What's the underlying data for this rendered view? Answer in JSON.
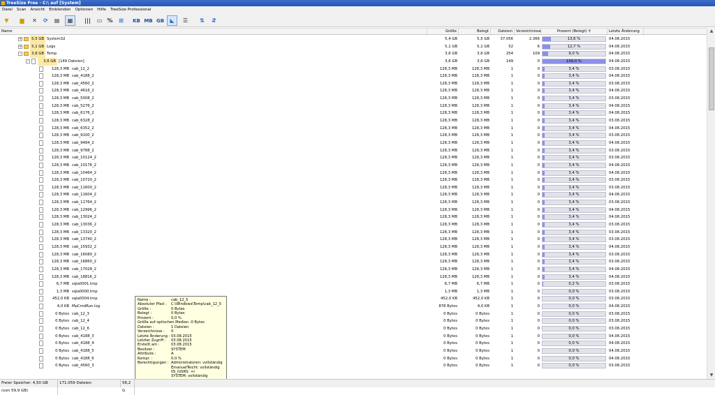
{
  "window": {
    "title": "TreeSize Free - C:\\  auf  [System]"
  },
  "menu": [
    "Datei",
    "Scan",
    "Ansicht",
    "Einblenden",
    "Optionen",
    "Hilfe",
    "TreeSize Professional"
  ],
  "toolbar": {
    "kb": "KB",
    "mb": "MB",
    "gb": "GB",
    "percent": "%"
  },
  "columns": [
    "Name",
    "Größe",
    "Belegt",
    "Dateien",
    "Verzeichnisse",
    "Prozent (Belegt)",
    "Letzte Änderung"
  ],
  "sort_indicator": "▼",
  "rows": [
    {
      "type": "folder",
      "level": 0,
      "expand": "+",
      "size": "5,5 GB",
      "name": "System32",
      "groesse": "5,4 GB",
      "belegt": "5,5 GB",
      "dateien": "37.056",
      "verz": "2.366",
      "pct": 13.6,
      "pct_label": "13,6 %",
      "date": "04.08.2015"
    },
    {
      "type": "folder",
      "level": 0,
      "expand": "+",
      "size": "5,1 GB",
      "name": "Logs",
      "groesse": "5,1 GB",
      "belegt": "5,1 GB",
      "dateien": "52",
      "verz": "6",
      "pct": 12.7,
      "pct_label": "12,7 %",
      "date": "04.08.2015"
    },
    {
      "type": "folder",
      "level": 0,
      "expand": "-",
      "size": "3,6 GB",
      "name": "Temp",
      "groesse": "3,6 GB",
      "belegt": "3,6 GB",
      "dateien": "254",
      "verz": "109",
      "pct": 9.0,
      "pct_label": "9,0 %",
      "date": "04.08.2015"
    },
    {
      "type": "files",
      "level": 1,
      "expand": "-",
      "size": "3,6 GB",
      "name": "[149 Dateien]",
      "groesse": "3,6 GB",
      "belegt": "3,6 GB",
      "dateien": "149",
      "verz": "0",
      "pct": 100.0,
      "pct_label": "100,0 %",
      "date": "04.08.2015"
    },
    {
      "type": "file",
      "level": 2,
      "size": "128,3 MB",
      "name": "cab_12_2",
      "groesse": "128,3 MB",
      "belegt": "128,3 MB",
      "dateien": "1",
      "verz": "0",
      "pct": 3.4,
      "pct_label": "3,4 %",
      "date": "03.08.2015"
    },
    {
      "type": "file",
      "level": 2,
      "size": "128,3 MB",
      "name": "cab_4188_2",
      "groesse": "128,3 MB",
      "belegt": "128,3 MB",
      "dateien": "1",
      "verz": "0",
      "pct": 3.4,
      "pct_label": "3,4 %",
      "date": "04.08.2015"
    },
    {
      "type": "file",
      "level": 2,
      "size": "128,3 MB",
      "name": "cab_4560_2",
      "groesse": "128,3 MB",
      "belegt": "128,3 MB",
      "dateien": "1",
      "verz": "0",
      "pct": 3.4,
      "pct_label": "3,4 %",
      "date": "03.08.2015"
    },
    {
      "type": "file",
      "level": 2,
      "size": "128,3 MB",
      "name": "cab_4616_2",
      "groesse": "128,3 MB",
      "belegt": "128,3 MB",
      "dateien": "1",
      "verz": "0",
      "pct": 3.4,
      "pct_label": "3,4 %",
      "date": "04.08.2015"
    },
    {
      "type": "file",
      "level": 2,
      "size": "128,3 MB",
      "name": "cab_5008_2",
      "groesse": "128,3 MB",
      "belegt": "128,3 MB",
      "dateien": "1",
      "verz": "0",
      "pct": 3.4,
      "pct_label": "3,4 %",
      "date": "03.08.2015"
    },
    {
      "type": "file",
      "level": 2,
      "size": "128,3 MB",
      "name": "cab_5276_2",
      "groesse": "128,3 MB",
      "belegt": "128,3 MB",
      "dateien": "1",
      "verz": "0",
      "pct": 3.4,
      "pct_label": "3,4 %",
      "date": "04.08.2015"
    },
    {
      "type": "file",
      "level": 2,
      "size": "128,3 MB",
      "name": "cab_6176_2",
      "groesse": "128,3 MB",
      "belegt": "128,3 MB",
      "dateien": "1",
      "verz": "0",
      "pct": 3.4,
      "pct_label": "3,4 %",
      "date": "04.08.2015"
    },
    {
      "type": "file",
      "level": 2,
      "size": "128,3 MB",
      "name": "cab_6328_2",
      "groesse": "128,3 MB",
      "belegt": "128,3 MB",
      "dateien": "1",
      "verz": "0",
      "pct": 3.4,
      "pct_label": "3,4 %",
      "date": "03.08.2015"
    },
    {
      "type": "file",
      "level": 2,
      "size": "128,3 MB",
      "name": "cab_6352_2",
      "groesse": "128,3 MB",
      "belegt": "128,3 MB",
      "dateien": "1",
      "verz": "0",
      "pct": 3.4,
      "pct_label": "3,4 %",
      "date": "04.08.2015"
    },
    {
      "type": "file",
      "level": 2,
      "size": "128,3 MB",
      "name": "cab_9100_2",
      "groesse": "128,3 MB",
      "belegt": "128,3 MB",
      "dateien": "1",
      "verz": "0",
      "pct": 3.4,
      "pct_label": "3,4 %",
      "date": "03.08.2015"
    },
    {
      "type": "file",
      "level": 2,
      "size": "128,3 MB",
      "name": "cab_9484_2",
      "groesse": "128,3 MB",
      "belegt": "128,3 MB",
      "dateien": "1",
      "verz": "0",
      "pct": 3.4,
      "pct_label": "3,4 %",
      "date": "04.08.2015"
    },
    {
      "type": "file",
      "level": 2,
      "size": "128,3 MB",
      "name": "cab_9788_2",
      "groesse": "128,3 MB",
      "belegt": "128,3 MB",
      "dateien": "1",
      "verz": "0",
      "pct": 3.4,
      "pct_label": "3,4 %",
      "date": "03.08.2015"
    },
    {
      "type": "file",
      "level": 2,
      "size": "128,3 MB",
      "name": "cab_10124_2",
      "groesse": "128,3 MB",
      "belegt": "128,3 MB",
      "dateien": "1",
      "verz": "0",
      "pct": 3.4,
      "pct_label": "3,4 %",
      "date": "03.08.2015"
    },
    {
      "type": "file",
      "level": 2,
      "size": "128,3 MB",
      "name": "cab_10176_2",
      "groesse": "128,3 MB",
      "belegt": "128,3 MB",
      "dateien": "1",
      "verz": "0",
      "pct": 3.4,
      "pct_label": "3,4 %",
      "date": "04.08.2015"
    },
    {
      "type": "file",
      "level": 2,
      "size": "128,3 MB",
      "name": "cab_10464_2",
      "groesse": "128,3 MB",
      "belegt": "128,3 MB",
      "dateien": "1",
      "verz": "0",
      "pct": 3.4,
      "pct_label": "3,4 %",
      "date": "04.08.2015"
    },
    {
      "type": "file",
      "level": 2,
      "size": "128,3 MB",
      "name": "cab_10720_2",
      "groesse": "128,3 MB",
      "belegt": "128,3 MB",
      "dateien": "1",
      "verz": "0",
      "pct": 3.4,
      "pct_label": "3,4 %",
      "date": "03.08.2015"
    },
    {
      "type": "file",
      "level": 2,
      "size": "128,3 MB",
      "name": "cab_11600_2",
      "groesse": "128,3 MB",
      "belegt": "128,3 MB",
      "dateien": "1",
      "verz": "0",
      "pct": 3.4,
      "pct_label": "3,4 %",
      "date": "03.08.2015"
    },
    {
      "type": "file",
      "level": 2,
      "size": "128,3 MB",
      "name": "cab_11604_2",
      "groesse": "128,3 MB",
      "belegt": "128,3 MB",
      "dateien": "1",
      "verz": "0",
      "pct": 3.4,
      "pct_label": "3,4 %",
      "date": "04.08.2015"
    },
    {
      "type": "file",
      "level": 2,
      "size": "128,3 MB",
      "name": "cab_11764_2",
      "groesse": "128,3 MB",
      "belegt": "128,3 MB",
      "dateien": "1",
      "verz": "0",
      "pct": 3.4,
      "pct_label": "3,4 %",
      "date": "03.08.2015"
    },
    {
      "type": "file",
      "level": 2,
      "size": "128,3 MB",
      "name": "cab_12996_2",
      "groesse": "128,3 MB",
      "belegt": "128,3 MB",
      "dateien": "1",
      "verz": "0",
      "pct": 3.4,
      "pct_label": "3,4 %",
      "date": "04.08.2015"
    },
    {
      "type": "file",
      "level": 2,
      "size": "128,3 MB",
      "name": "cab_13024_2",
      "groesse": "128,3 MB",
      "belegt": "128,3 MB",
      "dateien": "1",
      "verz": "0",
      "pct": 3.4,
      "pct_label": "3,4 %",
      "date": "04.08.2015"
    },
    {
      "type": "file",
      "level": 2,
      "size": "128,3 MB",
      "name": "cab_13036_2",
      "groesse": "128,3 MB",
      "belegt": "128,3 MB",
      "dateien": "1",
      "verz": "0",
      "pct": 3.4,
      "pct_label": "3,4 %",
      "date": "03.08.2015"
    },
    {
      "type": "file",
      "level": 2,
      "size": "128,3 MB",
      "name": "cab_13320_2",
      "groesse": "128,3 MB",
      "belegt": "128,3 MB",
      "dateien": "1",
      "verz": "0",
      "pct": 3.4,
      "pct_label": "3,4 %",
      "date": "03.08.2015"
    },
    {
      "type": "file",
      "level": 2,
      "size": "128,3 MB",
      "name": "cab_13740_2",
      "groesse": "128,3 MB",
      "belegt": "128,3 MB",
      "dateien": "1",
      "verz": "0",
      "pct": 3.4,
      "pct_label": "3,4 %",
      "date": "03.08.2015"
    },
    {
      "type": "file",
      "level": 2,
      "size": "128,3 MB",
      "name": "cab_15932_2",
      "groesse": "128,3 MB",
      "belegt": "128,3 MB",
      "dateien": "1",
      "verz": "0",
      "pct": 3.4,
      "pct_label": "3,4 %",
      "date": "04.08.2015"
    },
    {
      "type": "file",
      "level": 2,
      "size": "128,3 MB",
      "name": "cab_16080_2",
      "groesse": "128,3 MB",
      "belegt": "128,3 MB",
      "dateien": "1",
      "verz": "0",
      "pct": 3.4,
      "pct_label": "3,4 %",
      "date": "03.08.2015"
    },
    {
      "type": "file",
      "level": 2,
      "size": "128,3 MB",
      "name": "cab_16860_2",
      "groesse": "128,3 MB",
      "belegt": "128,3 MB",
      "dateien": "1",
      "verz": "0",
      "pct": 3.4,
      "pct_label": "3,4 %",
      "date": "03.08.2015"
    },
    {
      "type": "file",
      "level": 2,
      "size": "128,3 MB",
      "name": "cab_17028_2",
      "groesse": "128,3 MB",
      "belegt": "128,3 MB",
      "dateien": "1",
      "verz": "0",
      "pct": 3.4,
      "pct_label": "3,4 %",
      "date": "04.08.2015"
    },
    {
      "type": "file",
      "level": 2,
      "size": "128,3 MB",
      "name": "cab_18816_2",
      "groesse": "128,3 MB",
      "belegt": "128,3 MB",
      "dateien": "1",
      "verz": "0",
      "pct": 3.4,
      "pct_label": "3,4 %",
      "date": "04.08.2015"
    },
    {
      "type": "file",
      "level": 2,
      "size": "6,7 MB",
      "name": "sqla0001.tmp",
      "groesse": "6,7 MB",
      "belegt": "6,7 MB",
      "dateien": "1",
      "verz": "0",
      "pct": 0.2,
      "pct_label": "0,2 %",
      "date": "03.08.2015"
    },
    {
      "type": "file",
      "level": 2,
      "size": "1,3 MB",
      "name": "sqla0000.tmp",
      "groesse": "1,3 MB",
      "belegt": "1,3 MB",
      "dateien": "1",
      "verz": "0",
      "pct": 0.0,
      "pct_label": "0,0 %",
      "date": "03.08.2015"
    },
    {
      "type": "file",
      "level": 2,
      "size": "452,0 KB",
      "name": "sqla0004.tmp",
      "groesse": "452,0 KB",
      "belegt": "452,0 KB",
      "dateien": "1",
      "verz": "0",
      "pct": 0.0,
      "pct_label": "0,0 %",
      "date": "03.08.2015"
    },
    {
      "type": "file",
      "level": 2,
      "size": "4,0 KB",
      "name": "MpCmdRun.log",
      "groesse": "878 Bytes",
      "belegt": "4,0 KB",
      "dateien": "1",
      "verz": "0",
      "pct": 0.0,
      "pct_label": "0,0 %",
      "date": "04.08.2015"
    },
    {
      "type": "file",
      "level": 2,
      "size": "0 Bytes",
      "name": "cab_12_3",
      "groesse": "0 Bytes",
      "belegt": "0 Bytes",
      "dateien": "1",
      "verz": "0",
      "pct": 0.0,
      "pct_label": "0,0 %",
      "date": "03.08.2015"
    },
    {
      "type": "file",
      "level": 2,
      "size": "0 Bytes",
      "name": "cab_12_4",
      "groesse": "0 Bytes",
      "belegt": "0 Bytes",
      "dateien": "1",
      "verz": "0",
      "pct": 0.0,
      "pct_label": "0,0 %",
      "date": "03.08.2015"
    },
    {
      "type": "file",
      "level": 2,
      "size": "0 Bytes",
      "name": "cab_12_6",
      "groesse": "0 Bytes",
      "belegt": "0 Bytes",
      "dateien": "1",
      "verz": "0",
      "pct": 0.0,
      "pct_label": "0,0 %",
      "date": "03.08.2015"
    },
    {
      "type": "file",
      "level": 2,
      "size": "0 Bytes",
      "name": "cab_4188_3",
      "groesse": "0 Bytes",
      "belegt": "0 Bytes",
      "dateien": "1",
      "verz": "0",
      "pct": 0.0,
      "pct_label": "0,0 %",
      "date": "04.08.2015"
    },
    {
      "type": "file",
      "level": 2,
      "size": "0 Bytes",
      "name": "cab_4188_4",
      "groesse": "0 Bytes",
      "belegt": "0 Bytes",
      "dateien": "1",
      "verz": "0",
      "pct": 0.0,
      "pct_label": "0,0 %",
      "date": "04.08.2015"
    },
    {
      "type": "file",
      "level": 2,
      "size": "0 Bytes",
      "name": "cab_4188_5",
      "groesse": "0 Bytes",
      "belegt": "0 Bytes",
      "dateien": "1",
      "verz": "0",
      "pct": 0.0,
      "pct_label": "0,0 %",
      "date": "04.08.2015"
    },
    {
      "type": "file",
      "level": 2,
      "size": "0 Bytes",
      "name": "cab_4188_6",
      "groesse": "0 Bytes",
      "belegt": "0 Bytes",
      "dateien": "1",
      "verz": "0",
      "pct": 0.0,
      "pct_label": "0,0 %",
      "date": "04.08.2015"
    },
    {
      "type": "file",
      "level": 2,
      "size": "0 Bytes",
      "name": "cab_4560_3",
      "groesse": "0 Bytes",
      "belegt": "0 Bytes",
      "dateien": "1",
      "verz": "0",
      "pct": 0.0,
      "pct_label": "0,0 %",
      "date": "03.08.2015"
    }
  ],
  "tooltip": [
    {
      "k": "Name :",
      "v": "cab_12_5"
    },
    {
      "k": "Absoluter Pfad :",
      "v": "C:\\Windows\\Temp\\cab_12_5"
    },
    {
      "k": "Größe :",
      "v": "0 Bytes"
    },
    {
      "k": "Belegt :",
      "v": "0 Bytes"
    },
    {
      "k": "Prozent :",
      "v": "0,0 %"
    },
    {
      "k": "Größe auf optischen Medien :0 Bytes",
      "v": ""
    },
    {
      "k": "Dateien :",
      "v": "1 Dateien"
    },
    {
      "k": "Verzeichnisse :",
      "v": "0"
    },
    {
      "k": "Letzte Änderung :",
      "v": "03.08.2015"
    },
    {
      "k": "Letzter Zugriff :",
      "v": "03.08.2015"
    },
    {
      "k": "Erstellt am :",
      "v": "03.08.2015"
    },
    {
      "k": "Besitzer :",
      "v": "SYSTEM"
    },
    {
      "k": "Attribute :",
      "v": "A"
    },
    {
      "k": "Kompr. :",
      "v": "0,0 %"
    },
    {
      "k": "Berechtigungen :",
      "v": "Administratoren: vollständig"
    },
    {
      "k": "",
      "v": "EmanuelTeicht: vollständig"
    },
    {
      "k": "",
      "v": "IIS_IUSRS: +r"
    },
    {
      "k": "",
      "v": "SYSTEM: vollständig"
    }
  ],
  "status": {
    "free": "Freier Speicher: 4,50 GB  (von 59,9 GB)",
    "files": "171.059  Dateien",
    "extra": "56,2 G"
  }
}
